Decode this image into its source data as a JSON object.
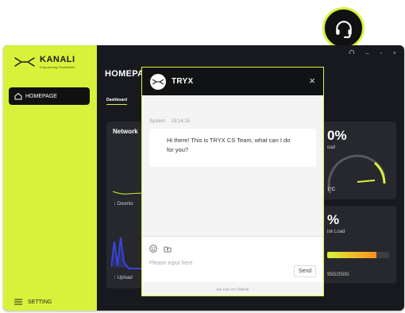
{
  "app": {
    "brand_name": "KANALI",
    "brand_tagline": "Empowering Possibilities",
    "nav_home": "HOMEPAGE",
    "nav_setting": "SETTING",
    "page_title": "HOMEPAGE",
    "tab_dashboard": "Dashboard"
  },
  "cards": {
    "network_title": "Network",
    "download_label": "Downlo",
    "upload_label": "Upload",
    "cpu_value": "0%",
    "cpu_sub": "oad",
    "cpu_temp": "1°C",
    "disk_value": "%",
    "disk_sub": "isk Load",
    "disk_usage": "95G/250G",
    "disk_fill_fraction": 0.8
  },
  "chat": {
    "title": "TRYX",
    "sender": "System",
    "time": "15:14:15",
    "message": "Hi there! This is TRYX CS Team, what can I do for you?",
    "placeholder": "Please input here",
    "send_label": "Send",
    "powered_by": "we run on Udesk",
    "close_icon": "×"
  },
  "colors": {
    "accent": "#d8f23b",
    "dark_bg": "#17191e",
    "card_bg": "#26282d"
  }
}
